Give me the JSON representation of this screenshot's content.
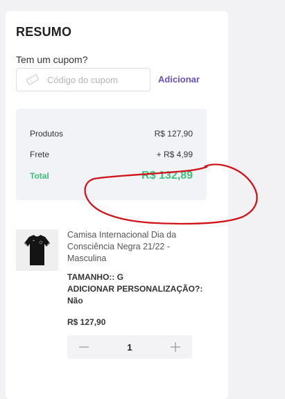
{
  "summary": {
    "title": "RESUMO",
    "coupon_label": "Tem um cupom?",
    "coupon_placeholder": "Código do cupom",
    "apply_label": "Adicionar",
    "products_label": "Produtos",
    "products_value": "R$ 127,90",
    "shipping_label": "Frete",
    "shipping_value": "+ R$ 4,99",
    "total_label": "Total",
    "total_value": "R$ 132,89"
  },
  "item": {
    "name": "Camisa Internacional Dia da Consciência Negra 21/22 - Masculina",
    "size": "TAMANHO:: G",
    "personalization_label": "ADICIONAR PERSONALIZAÇÃO?:",
    "personalization_value": "Não",
    "price": "R$ 127,90",
    "quantity": "1"
  },
  "colors": {
    "accent": "#6b4fbb",
    "total": "#3fbf7a",
    "annotation": "#d0141a"
  }
}
